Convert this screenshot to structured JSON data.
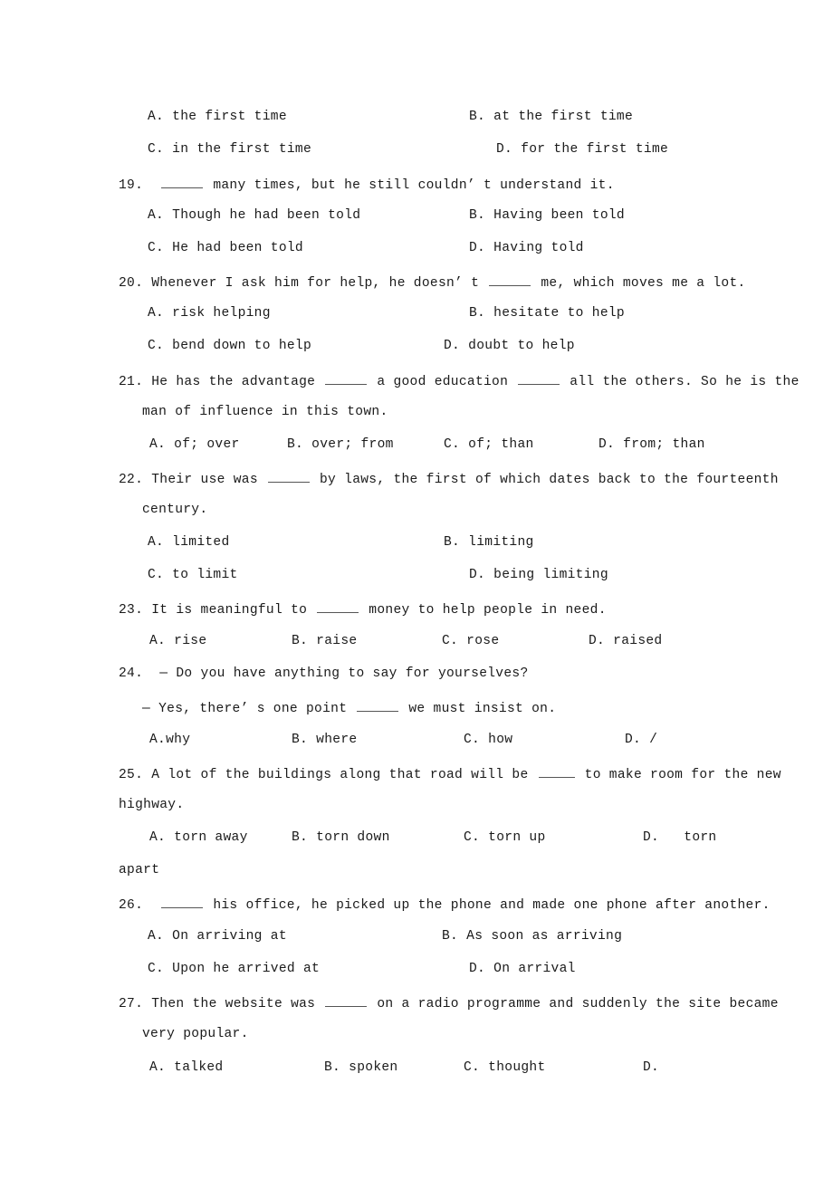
{
  "document": {
    "type": "english-grammar-worksheet",
    "page_background": "#ffffff",
    "text_color": "#1a1a1a"
  },
  "questions": [
    {
      "number": "",
      "stem_lines": [],
      "options": [
        {
          "label": "A.",
          "text": "the first time"
        },
        {
          "label": "B.",
          "text": "at the first time"
        },
        {
          "label": "C.",
          "text": "in the first time"
        },
        {
          "label": "D.",
          "text": "for the first time"
        }
      ]
    },
    {
      "number": "19.",
      "stem_pre": "",
      "stem_post": "many times, but he still couldn’ t understand it.",
      "options": [
        {
          "label": "A.",
          "text": "Though he had been told"
        },
        {
          "label": "B.",
          "text": "Having been told"
        },
        {
          "label": "C.",
          "text": "He had been told"
        },
        {
          "label": "D.",
          "text": "Having told"
        }
      ]
    },
    {
      "number": "20.",
      "stem_pre": "Whenever I ask him for help, he doesn’ t",
      "stem_post": "me, which moves me a lot.",
      "options": [
        {
          "label": "A.",
          "text": "risk helping"
        },
        {
          "label": "B.",
          "text": "hesitate to help"
        },
        {
          "label": "C.",
          "text": "bend down to help"
        },
        {
          "label": "D.",
          "text": "doubt to help"
        }
      ]
    },
    {
      "number": "21.",
      "stem_pre": "He has the advantage",
      "stem_mid": "a good education",
      "stem_post": "all the others. So he is the",
      "stem_line2": "man of influence in this town.",
      "options": [
        {
          "label": "A.",
          "text": "of; over"
        },
        {
          "label": "B.",
          "text": "over; from"
        },
        {
          "label": "C.",
          "text": "of; than"
        },
        {
          "label": "D.",
          "text": "from; than"
        }
      ]
    },
    {
      "number": "22.",
      "stem_pre": "Their use was",
      "stem_post": "by laws, the first of which dates back to the fourteenth",
      "stem_line2": "century.",
      "options": [
        {
          "label": "A.",
          "text": "limited"
        },
        {
          "label": "B.",
          "text": "limiting"
        },
        {
          "label": "C.",
          "text": "to limit"
        },
        {
          "label": "D.",
          "text": "being limiting"
        }
      ]
    },
    {
      "number": "23.",
      "stem_pre": "It is meaningful to",
      "stem_post": "money to help people in need.",
      "options": [
        {
          "label": "A.",
          "text": "rise"
        },
        {
          "label": "B.",
          "text": "raise"
        },
        {
          "label": "C.",
          "text": "rose"
        },
        {
          "label": "D.",
          "text": "raised"
        }
      ]
    },
    {
      "number": "24.",
      "stem_line1": "— Do you have anything to say for yourselves?",
      "stem_line2_pre": "— Yes, there’ s one point",
      "stem_line2_post": "we must insist on.",
      "options": [
        {
          "label": "A.",
          "text": "why"
        },
        {
          "label": "B.",
          "text": "where"
        },
        {
          "label": "C.",
          "text": "how"
        },
        {
          "label": "D.",
          "text": "/"
        }
      ]
    },
    {
      "number": "25.",
      "stem_pre": "A lot of the buildings along that road will be",
      "stem_post": "to make room for the new",
      "stem_line2": "highway.",
      "options": [
        {
          "label": "A.",
          "text": "torn away"
        },
        {
          "label": "B.",
          "text": "torn down"
        },
        {
          "label": "C.",
          "text": "torn up"
        },
        {
          "label": "D.",
          "text": "torn"
        }
      ],
      "option_overflow": "apart"
    },
    {
      "number": "26.",
      "stem_pre": "",
      "stem_post": "his office, he picked up the phone and made one phone after another.",
      "options": [
        {
          "label": "A.",
          "text": "On arriving at"
        },
        {
          "label": "B.",
          "text": "As soon as arriving"
        },
        {
          "label": "C.",
          "text": "Upon he arrived at"
        },
        {
          "label": "D.",
          "text": "On arrival"
        }
      ]
    },
    {
      "number": "27.",
      "stem_pre": "Then the website was",
      "stem_post": "on a radio programme and suddenly the site became",
      "stem_line2": "very popular.",
      "options": [
        {
          "label": "A.",
          "text": "talked"
        },
        {
          "label": "B.",
          "text": "spoken"
        },
        {
          "label": "C.",
          "text": "thought"
        },
        {
          "label": "D.",
          "text": ""
        }
      ]
    }
  ]
}
